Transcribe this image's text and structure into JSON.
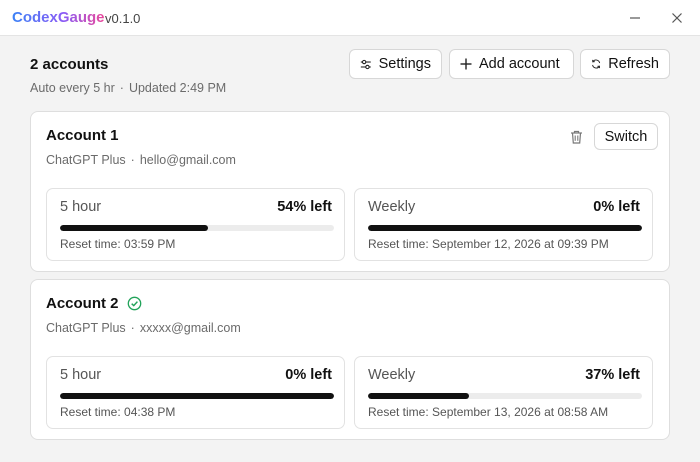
{
  "app": {
    "name": "CodexGauge",
    "version": "v0.1.0"
  },
  "window": {
    "minimize_icon": "minimize-icon",
    "close_icon": "close-icon"
  },
  "header": {
    "count_label": "2 accounts",
    "auto_text": "Auto every 5 hr",
    "separator": "·",
    "updated_text": "Updated 2:49 PM"
  },
  "toolbar": {
    "settings_label": "Settings",
    "add_label": "Add account",
    "refresh_label": "Refresh",
    "icons": {
      "settings": "sliders-icon",
      "add": "plus-icon",
      "refresh": "refresh-icon"
    }
  },
  "accounts": [
    {
      "name": "Account 1",
      "active": false,
      "plan": "ChatGPT Plus",
      "separator": "·",
      "email": "hello@gmail.com",
      "switch_label": "Switch",
      "usage": [
        {
          "label": "5 hour",
          "pct_text": "54% left",
          "remaining": 0.54,
          "reset": "Reset time: 03:59 PM"
        },
        {
          "label": "Weekly",
          "pct_text": "0% left",
          "remaining": 1.0,
          "reset": "Reset time: September 12, 2026 at 09:39 PM"
        }
      ]
    },
    {
      "name": "Account 2",
      "active": true,
      "plan": "ChatGPT Plus",
      "separator": "·",
      "email": "xxxxx@gmail.com",
      "usage": [
        {
          "label": "5 hour",
          "pct_text": "0% left",
          "remaining": 1.0,
          "reset": "Reset time: 04:38 PM"
        },
        {
          "label": "Weekly",
          "pct_text": "37% left",
          "remaining": 0.37,
          "reset": "Reset time: September 13, 2026 at 08:58 AM"
        }
      ]
    }
  ],
  "colors": {
    "brand_from": "#3b82f6",
    "brand_to": "#ec4899",
    "active_check": "#22a35a",
    "bar_fill": "#111111",
    "bar_track": "#ececec"
  }
}
